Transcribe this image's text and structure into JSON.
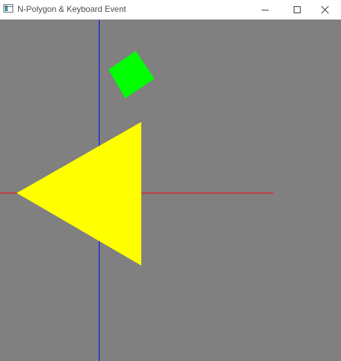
{
  "window": {
    "title": "N-Polygon & Keyboard Event"
  },
  "icons": {
    "app": "app-window-icon",
    "minimize": "minimize-icon",
    "maximize": "maximize-icon",
    "close": "close-icon"
  },
  "colors": {
    "canvas_background": "#808080",
    "x_axis": "#ff0000",
    "y_axis": "#0000ff",
    "triangle": "#ffff00",
    "square": "#00ff00"
  }
}
